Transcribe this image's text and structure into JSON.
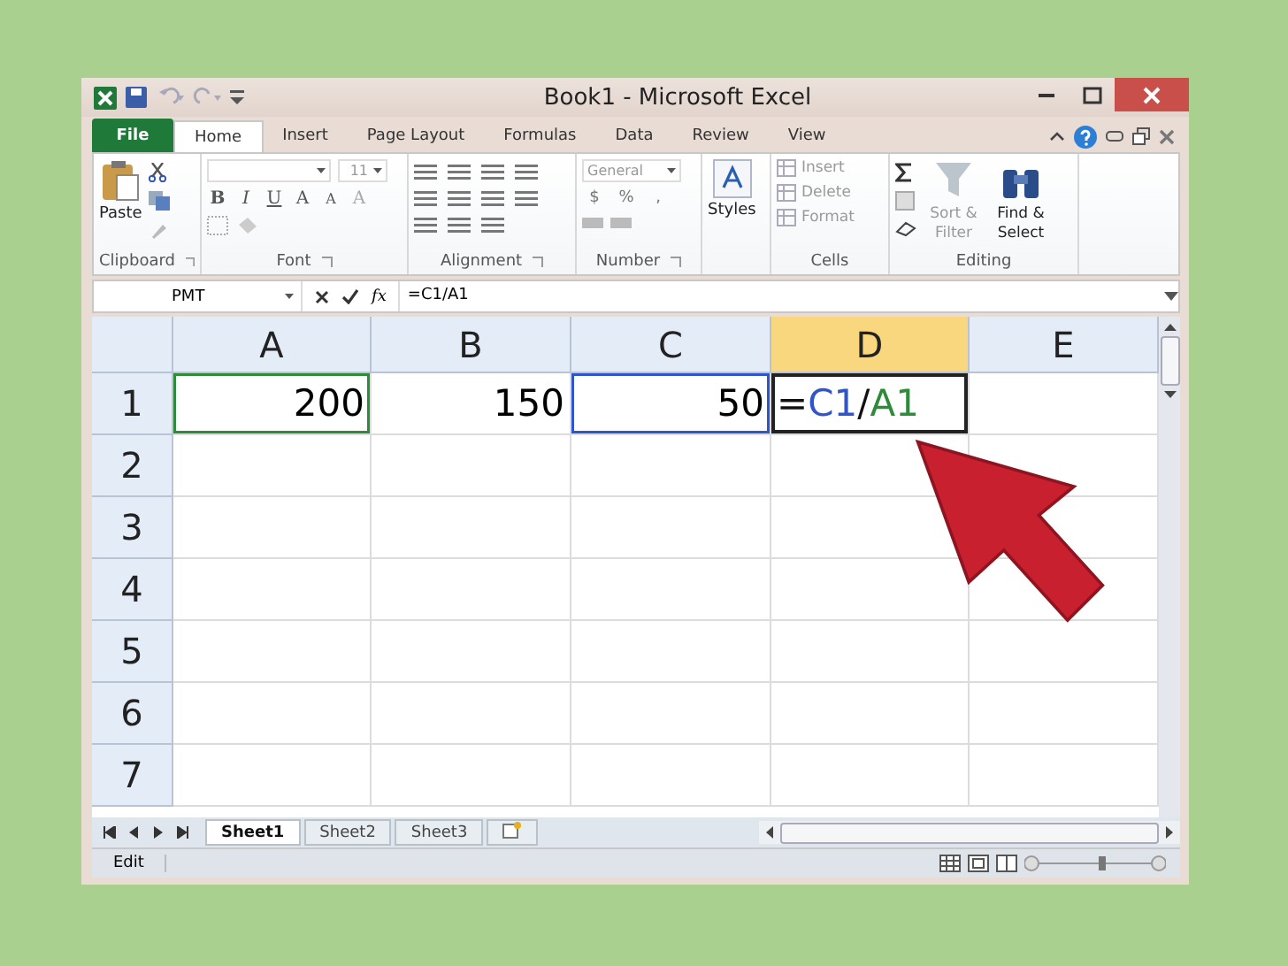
{
  "window": {
    "title": "Book1 - Microsoft Excel"
  },
  "ribbon": {
    "tabs": [
      {
        "label": "File",
        "kind": "file",
        "selected": false
      },
      {
        "label": "Home",
        "kind": "tab",
        "selected": true
      },
      {
        "label": "Insert",
        "kind": "tab",
        "selected": false
      },
      {
        "label": "Page Layout",
        "kind": "tab",
        "selected": false
      },
      {
        "label": "Formulas",
        "kind": "tab",
        "selected": false
      },
      {
        "label": "Data",
        "kind": "tab",
        "selected": false
      },
      {
        "label": "Review",
        "kind": "tab",
        "selected": false
      },
      {
        "label": "View",
        "kind": "tab",
        "selected": false
      }
    ],
    "groups": [
      {
        "label": "Clipboard",
        "kind": "clipboard",
        "items": [
          {
            "label": "Paste",
            "disabled": false
          }
        ]
      },
      {
        "label": "Font",
        "kind": "font",
        "size": "11",
        "letters": [
          "B",
          "I",
          "U",
          "A",
          "A",
          "A"
        ]
      },
      {
        "label": "Alignment",
        "kind": "alignment"
      },
      {
        "label": "Number",
        "kind": "number",
        "format": "General",
        "symbols": [
          "$",
          "%",
          ","
        ]
      },
      {
        "kind": "styles",
        "items": [
          {
            "label": "Styles",
            "disabled": false
          }
        ]
      },
      {
        "label": "Cells",
        "kind": "cells",
        "items": [
          {
            "label": "Insert",
            "disabled": true
          },
          {
            "label": "Delete",
            "disabled": true
          },
          {
            "label": "Format",
            "disabled": true
          }
        ]
      },
      {
        "label": "Editing",
        "kind": "editing",
        "items": [
          {
            "label": "Sort & Filter",
            "disabled": true
          },
          {
            "label": "Find & Select",
            "disabled": false
          }
        ]
      }
    ]
  },
  "formula_bar": {
    "name_box": "PMT",
    "function_button": "fx",
    "formula": "=C1/A1"
  },
  "sheet": {
    "columns": [
      {
        "label": "A",
        "selected": false
      },
      {
        "label": "B",
        "selected": false
      },
      {
        "label": "C",
        "selected": false
      },
      {
        "label": "D",
        "selected": true
      },
      {
        "label": "E",
        "selected": false
      }
    ],
    "rows": [
      {
        "header": "1",
        "cells": [
          {
            "value": "200",
            "color": "#2e8b3a"
          },
          {
            "value": "150"
          },
          {
            "value": "50",
            "color": "#2f55c8"
          },
          {
            "editing": true,
            "parts": [
              {
                "text": "=",
                "color": "#111111"
              },
              {
                "text": "C1",
                "color": "#2f55c8"
              },
              {
                "text": "/",
                "color": "#111111"
              },
              {
                "text": "A1",
                "color": "#2e8b3a"
              }
            ]
          },
          {}
        ]
      },
      {
        "header": "2",
        "cells": []
      },
      {
        "header": "3",
        "cells": []
      },
      {
        "header": "4",
        "cells": []
      },
      {
        "header": "5",
        "cells": []
      },
      {
        "header": "6",
        "cells": []
      },
      {
        "header": "7",
        "cells": []
      }
    ]
  },
  "sheet_tabs": [
    {
      "label": "Sheet1",
      "selected": true
    },
    {
      "label": "Sheet2",
      "selected": false
    },
    {
      "label": "Sheet3",
      "selected": false
    }
  ],
  "status_bar": {
    "mode": "Edit"
  }
}
